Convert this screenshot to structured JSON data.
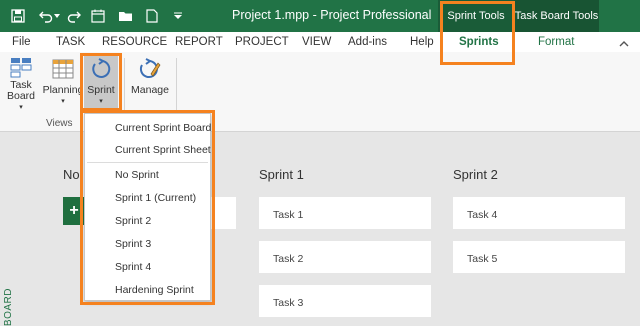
{
  "titlebar": {
    "title": "Project 1.mpp  -  Project Professional",
    "context_sprint_tools": "Sprint Tools",
    "context_taskboard_tools": "Task Board Tools"
  },
  "tabs": {
    "file": "File",
    "task": "TASK",
    "resource": "RESOURCE",
    "report": "REPORT",
    "project": "PROJECT",
    "view": "VIEW",
    "addins": "Add-ins",
    "help": "Help",
    "sprints": "Sprints",
    "format": "Format"
  },
  "ribbon": {
    "taskboard_line1": "Task",
    "taskboard_line2": "Board",
    "planning": "Planning",
    "sprint": "Sprint",
    "manage": "Manage",
    "views_group": "Views"
  },
  "dropdown": {
    "items": [
      "Current Sprint Board",
      "Current Sprint Sheet",
      "No Sprint",
      "Sprint 1 (Current)",
      "Sprint 2",
      "Sprint 3",
      "Sprint 4",
      "Hardening Sprint"
    ]
  },
  "board": {
    "col0_title": "No",
    "col1_title": "Sprint 1",
    "col2_title": "Sprint 2",
    "sprint1_cards": [
      "Task 1",
      "Task 2",
      "Task 3"
    ],
    "sprint2_cards": [
      "Task 4",
      "Task 5"
    ],
    "add_symbol": "+",
    "side_tab": "BOARD"
  },
  "colors": {
    "brand_green": "#217346",
    "highlight_orange": "#f5821f"
  }
}
